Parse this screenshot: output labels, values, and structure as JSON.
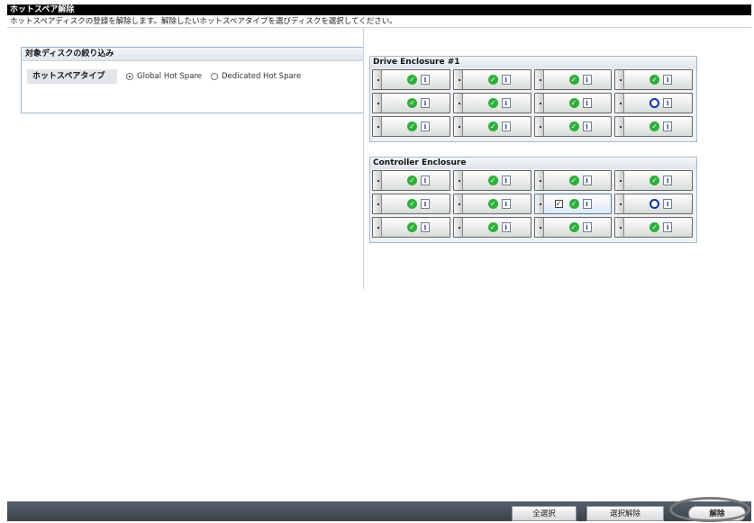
{
  "window": {
    "title": "ホットスペア解除",
    "description": "ホットスペアディスクの登録を解除します。解除したいホットスペアタイプを選びディスクを選択してください。"
  },
  "filter": {
    "header": "対象ディスクの絞り込み",
    "label": "ホットスペアタイプ",
    "options": [
      {
        "label": "Global Hot Spare",
        "selected": true
      },
      {
        "label": "Dedicated Hot Spare",
        "selected": false
      }
    ]
  },
  "enclosures": [
    {
      "name": "Drive Enclosure #1",
      "rows": [
        [
          {
            "status": "ok"
          },
          {
            "status": "ok"
          },
          {
            "status": "ok"
          },
          {
            "status": "ok"
          }
        ],
        [
          {
            "status": "ok"
          },
          {
            "status": "ok"
          },
          {
            "status": "ok"
          },
          {
            "status": "spare"
          }
        ],
        [
          {
            "status": "ok"
          },
          {
            "status": "ok"
          },
          {
            "status": "ok"
          },
          {
            "status": "ok"
          }
        ]
      ]
    },
    {
      "name": "Controller Enclosure",
      "rows": [
        [
          {
            "status": "ok"
          },
          {
            "status": "ok"
          },
          {
            "status": "ok"
          },
          {
            "status": "ok"
          }
        ],
        [
          {
            "status": "ok"
          },
          {
            "status": "ok"
          },
          {
            "status": "ok",
            "checkbox": true,
            "checked": true
          },
          {
            "status": "spare"
          }
        ],
        [
          {
            "status": "ok"
          },
          {
            "status": "ok"
          },
          {
            "status": "ok"
          },
          {
            "status": "ok"
          }
        ]
      ]
    }
  ],
  "icons": {
    "ok": "check-circle-icon",
    "spare": "hot-spare-ring-icon",
    "info": "info-icon",
    "slot_tab": "drive-latch-icon"
  },
  "colors": {
    "ok": "#2fae3c",
    "spare": "#1130a8",
    "titlebar": "#000000"
  },
  "buttons": {
    "select_all": "全選択",
    "deselect": "選択解除",
    "release": "解除"
  }
}
